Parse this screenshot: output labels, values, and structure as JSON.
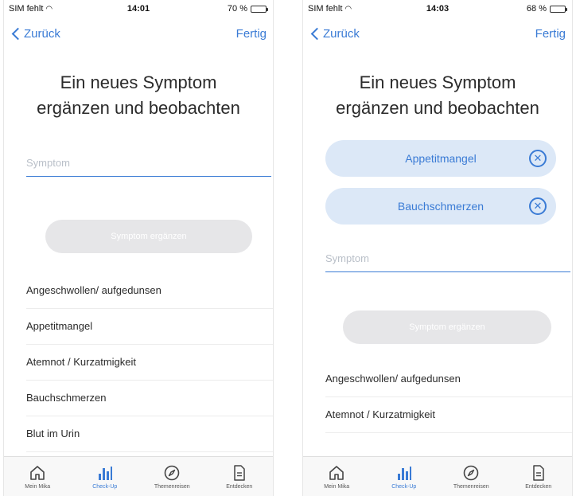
{
  "screens": [
    {
      "status": {
        "carrier": "SIM fehlt",
        "time": "14:01",
        "battery": "70 %",
        "battery_level": 0.7
      },
      "nav": {
        "back_label": "Zurück",
        "done_label": "Fertig"
      },
      "title_line1": "Ein neues Symptom",
      "title_line2": "ergänzen und beobachten",
      "chips": [],
      "input": {
        "placeholder": "Symptom",
        "value": ""
      },
      "add_button_label": "Symptom ergänzen",
      "suggestions": [
        "Angeschwollen/ aufgedunsen",
        "Appetitmangel",
        "Atemnot / Kurzatmigkeit",
        "Bauchschmerzen",
        "Blut im Urin"
      ],
      "tabs": [
        {
          "label": "Mein Mika",
          "icon": "home-icon",
          "active": false
        },
        {
          "label": "Check-Up",
          "icon": "bar-chart-icon",
          "active": true
        },
        {
          "label": "Themenreisen",
          "icon": "compass-icon",
          "active": false
        },
        {
          "label": "Entdecken",
          "icon": "document-icon",
          "active": false
        }
      ]
    },
    {
      "status": {
        "carrier": "SIM fehlt",
        "time": "14:03",
        "battery": "68 %",
        "battery_level": 0.68
      },
      "nav": {
        "back_label": "Zurück",
        "done_label": "Fertig"
      },
      "title_line1": "Ein neues Symptom",
      "title_line2": "ergänzen und beobachten",
      "chips": [
        {
          "label": "Appetitmangel",
          "icon": "close-circle-icon"
        },
        {
          "label": "Bauchschmerzen",
          "icon": "close-circle-icon"
        }
      ],
      "input": {
        "placeholder": "Symptom",
        "value": ""
      },
      "add_button_label": "Symptom ergänzen",
      "suggestions": [
        "Angeschwollen/ aufgedunsen",
        "Atemnot / Kurzatmigkeit"
      ],
      "tabs": [
        {
          "label": "Mein Mika",
          "icon": "home-icon",
          "active": false
        },
        {
          "label": "Check-Up",
          "icon": "bar-chart-icon",
          "active": true
        },
        {
          "label": "Themenreisen",
          "icon": "compass-icon",
          "active": false
        },
        {
          "label": "Entdecken",
          "icon": "document-icon",
          "active": false
        }
      ]
    }
  ],
  "colors": {
    "accent": "#3a7bd5",
    "chip_bg": "#dce8f7",
    "button_disabled_bg": "#e6e6e8",
    "text": "#2b2b2b"
  }
}
